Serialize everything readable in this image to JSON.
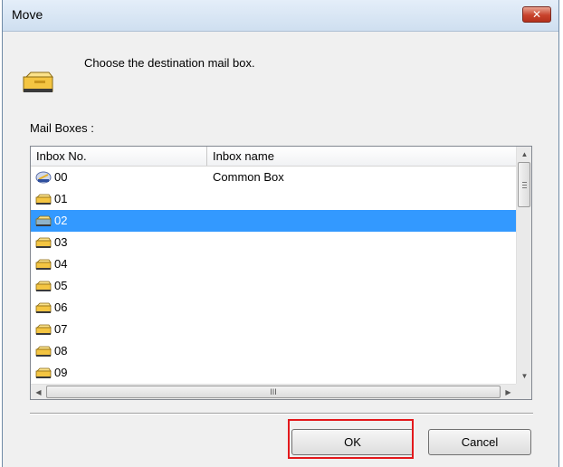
{
  "window": {
    "title": "Move",
    "close_glyph": "✕"
  },
  "dialog": {
    "prompt": "Choose the destination mail box.",
    "list_label": "Mail Boxes :",
    "columns": [
      "Inbox No.",
      "Inbox name"
    ],
    "rows": [
      {
        "no": "00",
        "name": "Common Box",
        "icon": "common-mailbox-icon",
        "selected": false
      },
      {
        "no": "01",
        "name": "",
        "icon": "mailbox-icon",
        "selected": false
      },
      {
        "no": "02",
        "name": "",
        "icon": "mailbox-icon",
        "selected": true
      },
      {
        "no": "03",
        "name": "",
        "icon": "mailbox-icon",
        "selected": false
      },
      {
        "no": "04",
        "name": "",
        "icon": "mailbox-icon",
        "selected": false
      },
      {
        "no": "05",
        "name": "",
        "icon": "mailbox-icon",
        "selected": false
      },
      {
        "no": "06",
        "name": "",
        "icon": "mailbox-icon",
        "selected": false
      },
      {
        "no": "07",
        "name": "",
        "icon": "mailbox-icon",
        "selected": false
      },
      {
        "no": "08",
        "name": "",
        "icon": "mailbox-icon",
        "selected": false
      },
      {
        "no": "09",
        "name": "",
        "icon": "mailbox-icon",
        "selected": false
      }
    ],
    "ok_label": "OK",
    "cancel_label": "Cancel",
    "grip_glyph": "III"
  },
  "colors": {
    "selection": "#3399ff",
    "highlight_border": "#e3191c",
    "close_button": "#c8432c",
    "mailbox_yellow": "#f4c542"
  }
}
